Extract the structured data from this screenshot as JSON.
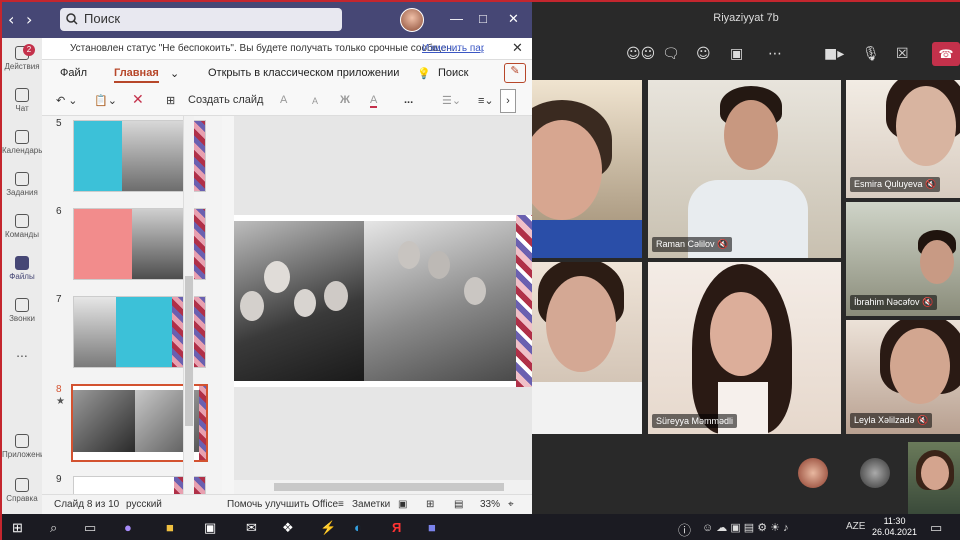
{
  "teams": {
    "search_placeholder": "Поиск",
    "notice_text": "Установлен статус \"Не беспокоить\". Вы будете получать только срочные сообщен...",
    "notice_link": "Изменить пар",
    "rail": [
      {
        "label": "Действия",
        "badge": "2"
      },
      {
        "label": "Чат"
      },
      {
        "label": "Календарь"
      },
      {
        "label": "Задания"
      },
      {
        "label": "Команды"
      },
      {
        "label": "Файлы"
      },
      {
        "label": "Звонки"
      },
      {
        "label": "..."
      },
      {
        "label": "Приложения"
      },
      {
        "label": "Справка"
      }
    ]
  },
  "ribbon": {
    "tabs": [
      "Файл",
      "Главная",
      "Открыть в классическом приложении",
      "Поиск"
    ],
    "cmd_new_slide": "Создать слайд",
    "cmd_font_a1": "A",
    "cmd_font_a2": "A",
    "cmd_bold": "Ж",
    "cmd_color": "A",
    "cmd_more": "..."
  },
  "slides": {
    "numbers": [
      "5",
      "6",
      "7",
      "8",
      "9"
    ],
    "selected_marker": "★"
  },
  "statusbar": {
    "slide_info": "Слайд 8 из 10",
    "language": "русский",
    "help": "Помочь улучшить Office",
    "notes": "Заметки",
    "zoom": "33%"
  },
  "meeting": {
    "title": "Riyaziyyat 7b",
    "participants": [
      {
        "name": "Raman Cəlilov"
      },
      {
        "name": "Esmira Quluyeva"
      },
      {
        "name": "İbrahim Nəcəfov"
      },
      {
        "name": "Süreyya Məmmədli"
      },
      {
        "name": "Leyla Xəlilzadə"
      }
    ]
  },
  "taskbar": {
    "lang": "AZE",
    "time": "11:30",
    "date": "26.04.2021"
  }
}
